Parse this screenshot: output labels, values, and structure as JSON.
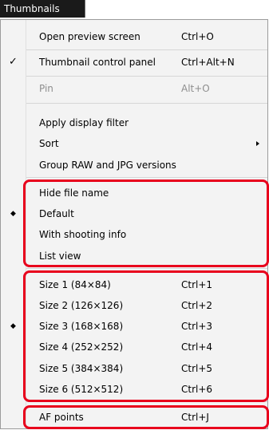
{
  "menubar": {
    "title": "Thumbnails"
  },
  "menu": {
    "items": [
      {
        "label": "Open preview screen",
        "shortcut": "Ctrl+O"
      },
      {
        "label": "Thumbnail control panel",
        "shortcut": "Ctrl+Alt+N",
        "checked": true
      },
      {
        "label": "Pin",
        "shortcut": "Alt+O",
        "disabled": true
      },
      {
        "label": "Apply display filter",
        "shortcut": ""
      },
      {
        "label": "Sort",
        "shortcut": "",
        "submenu": true
      },
      {
        "label": "Group RAW and JPG versions",
        "shortcut": ""
      },
      {
        "label": "Hide file name",
        "shortcut": ""
      },
      {
        "label": "Default",
        "shortcut": "",
        "selected": true
      },
      {
        "label": "With shooting info",
        "shortcut": ""
      },
      {
        "label": "List view",
        "shortcut": ""
      },
      {
        "label": "Size 1 (84×84)",
        "shortcut": "Ctrl+1"
      },
      {
        "label": "Size 2 (126×126)",
        "shortcut": "Ctrl+2"
      },
      {
        "label": "Size 3 (168×168)",
        "shortcut": "Ctrl+3",
        "selected": true
      },
      {
        "label": "Size 4 (252×252)",
        "shortcut": "Ctrl+4"
      },
      {
        "label": "Size 5 (384×384)",
        "shortcut": "Ctrl+5"
      },
      {
        "label": "Size 6 (512×512)",
        "shortcut": "Ctrl+6"
      },
      {
        "label": "AF points",
        "shortcut": "Ctrl+J"
      }
    ],
    "check_glyph": "✓",
    "radio_glyph": "◆",
    "highlight_color": "#e8001c"
  }
}
